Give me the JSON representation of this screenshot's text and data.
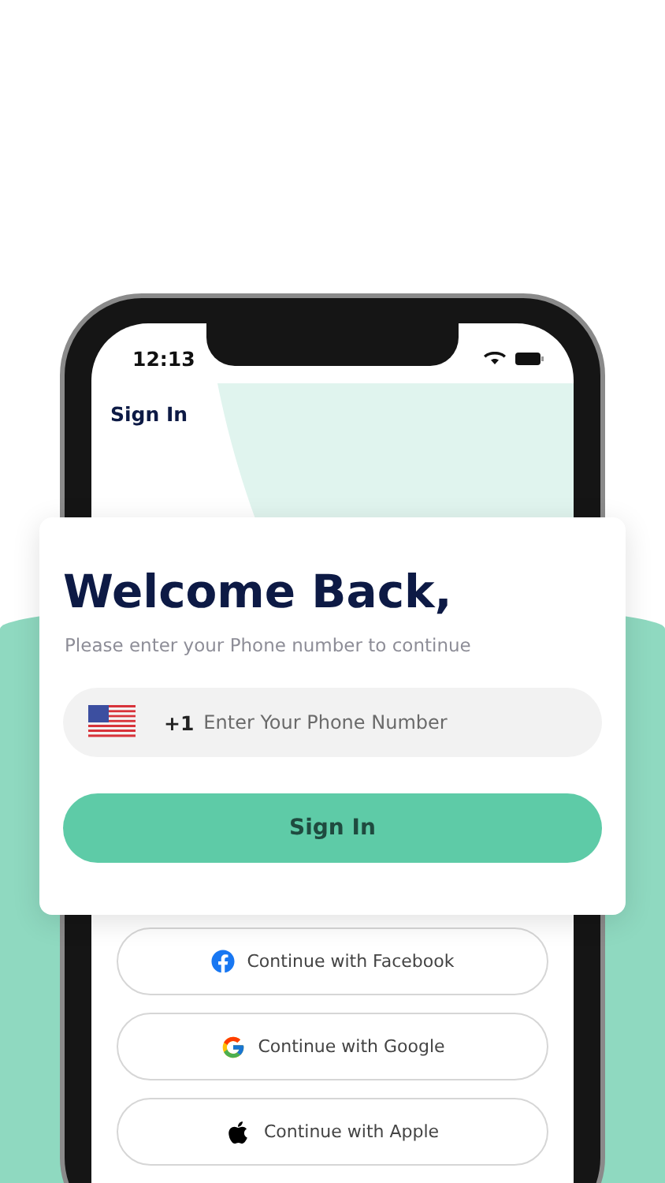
{
  "status_bar": {
    "time": "12:13"
  },
  "nav": {
    "title": "Sign In"
  },
  "card": {
    "title": "Welcome Back,",
    "subtitle": "Please enter your Phone number to continue",
    "phone_field": {
      "country_code": "+1",
      "placeholder": "Enter Your Phone Number"
    },
    "button": "Sign In"
  },
  "social_buttons": [
    {
      "kind": "facebook",
      "label": "Continue with Facebook"
    },
    {
      "kind": "google",
      "label": "Continue with Google"
    },
    {
      "kind": "apple",
      "label": "Continue with Apple"
    }
  ]
}
